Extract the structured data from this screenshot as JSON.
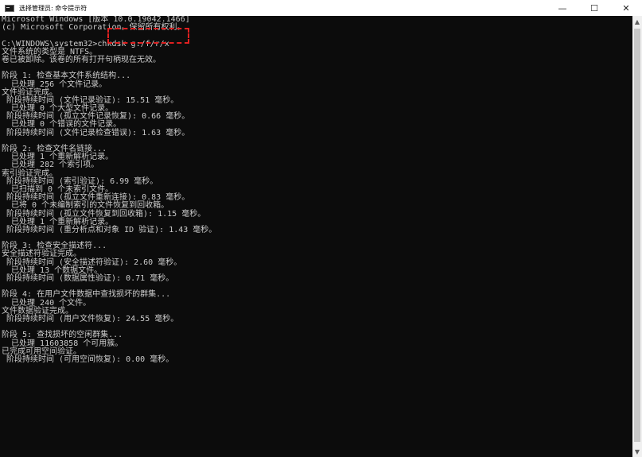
{
  "window": {
    "title": "选择管理员: 命令提示符",
    "controls": {
      "minimize": "—",
      "maximize": "☐",
      "close": "✕"
    }
  },
  "console": {
    "lines": [
      "Microsoft Windows [版本 10.0.19042.1466]",
      "(c) Microsoft Corporation。保留所有权利。",
      "",
      "C:\\WINDOWS\\system32>chkdsk g:/f/r/x",
      "文件系统的类型是 NTFS。",
      "卷已被卸除。该卷的所有打开句柄现在无效。",
      "",
      "阶段 1: 检查基本文件系统结构...",
      "  已处理 256 个文件记录。",
      "文件验证完成。",
      " 阶段持续时间 (文件记录验证): 15.51 毫秒。",
      "  已处理 0 个大型文件记录。",
      " 阶段持续时间 (孤立文件记录恢复): 0.66 毫秒。",
      "  已处理 0 个错误的文件记录。",
      " 阶段持续时间 (文件记录检查错误): 1.63 毫秒。",
      "",
      "阶段 2: 检查文件名链接...",
      "  已处理 1 个重新解析记录。",
      "  已处理 282 个索引项。",
      "索引验证完成。",
      " 阶段持续时间 (索引验证): 6.99 毫秒。",
      "  已扫描到 0 个未索引文件。",
      " 阶段持续时间 (孤立文件重新连接): 0.83 毫秒。",
      "  已将 0 个未编制索引的文件恢复到回收箱。",
      " 阶段持续时间 (孤立文件恢复到回收箱): 1.15 毫秒。",
      "  已处理 1 个重新解析记录。",
      " 阶段持续时间 (重分析点和对象 ID 验证): 1.43 毫秒。",
      "",
      "阶段 3: 检查安全描述符...",
      "安全描述符验证完成。",
      " 阶段持续时间 (安全描述符验证): 2.60 毫秒。",
      "  已处理 13 个数据文件。",
      " 阶段持续时间 (数据属性验证): 0.71 毫秒。",
      "",
      "阶段 4: 在用户文件数据中查找损坏的群集...",
      "  已处理 240 个文件。",
      "文件数据验证完成。",
      " 阶段持续时间 (用户文件恢复): 24.55 毫秒。",
      "",
      "阶段 5: 查找损坏的空闲群集...",
      "  已处理 11603858 个可用簇。",
      "已完成可用空间验证。",
      " 阶段持续时间 (可用空间恢复): 0.00 毫秒。"
    ]
  },
  "scrollbar": {
    "up": "▲",
    "down": "▼"
  },
  "colors": {
    "console_bg": "#0c0c0c",
    "console_fg": "#cccccc",
    "highlight": "#e02020"
  }
}
